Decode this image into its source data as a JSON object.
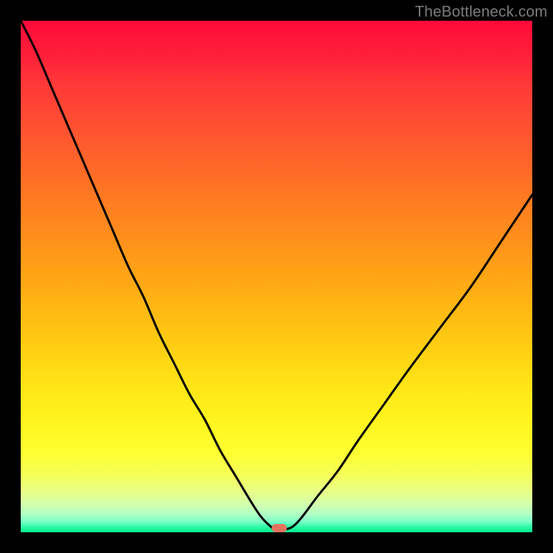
{
  "watermark": "TheBottleneck.com",
  "chart_data": {
    "type": "line",
    "title": "",
    "xlabel": "",
    "ylabel": "",
    "xlim": [
      0,
      100
    ],
    "ylim": [
      0,
      100
    ],
    "series": [
      {
        "name": "bottleneck-curve",
        "x": [
          0,
          3,
          6,
          9,
          12,
          15,
          18,
          21,
          24,
          27,
          30,
          33,
          36,
          39,
          42,
          45,
          47,
          49,
          50,
          51,
          53,
          55,
          58,
          62,
          66,
          71,
          76,
          82,
          88,
          94,
          100
        ],
        "y": [
          100,
          94,
          87,
          80,
          73,
          66,
          59,
          52,
          46,
          39,
          33,
          27,
          22,
          16,
          11,
          6,
          3,
          1,
          0.5,
          0.5,
          1,
          3,
          7,
          12,
          18,
          25,
          32,
          40,
          48,
          57,
          66
        ]
      }
    ],
    "marker": {
      "x": 50.5,
      "y": 0.8
    },
    "colors": {
      "curve": "#000000",
      "marker": "#e2735f",
      "gradient_top": "#ff0a3a",
      "gradient_bottom": "#00eb8e"
    }
  }
}
